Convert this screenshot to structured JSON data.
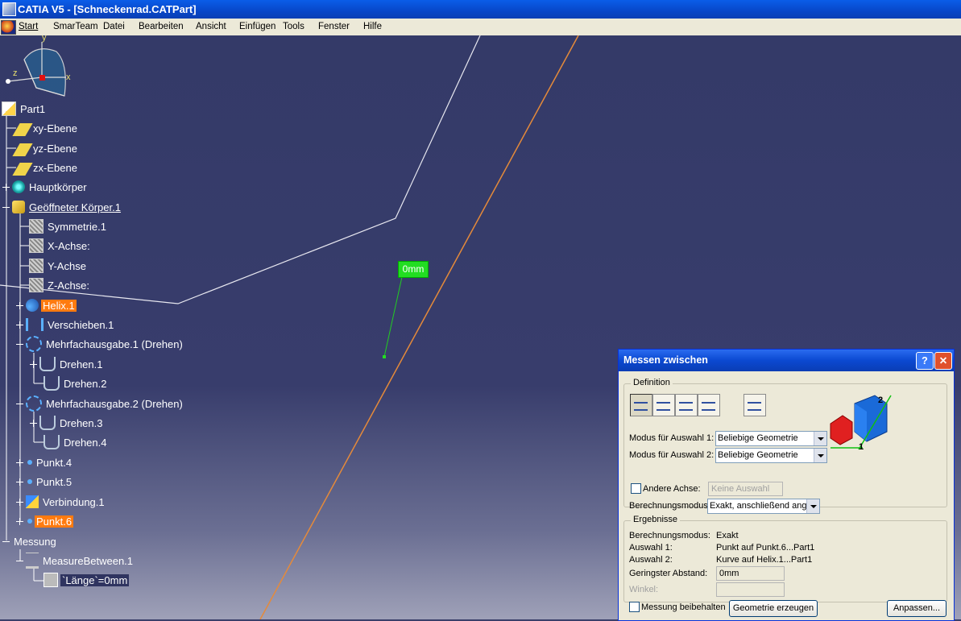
{
  "window": {
    "title": "CATIA V5 - [Schneckenrad.CATPart]"
  },
  "menu": {
    "items": [
      "Start",
      "SmarTeam",
      "Datei",
      "Bearbeiten",
      "Ansicht",
      "Einfügen",
      "Tools",
      "Fenster",
      "Hilfe"
    ]
  },
  "tree": {
    "root": "Part1",
    "xy": "xy-Ebene",
    "yz": "yz-Ebene",
    "zx": "zx-Ebene",
    "haupt": "Hauptkörper",
    "open_body": "Geöffneter Körper.1",
    "sym": "Symmetrie.1",
    "xaxis": "X-Achse:",
    "yaxis": "Y-Achse",
    "zaxis": "Z-Achse:",
    "helix": "Helix.1",
    "shift": "Verschieben.1",
    "multi1": "Mehrfachausgabe.1 (Drehen)",
    "drehen1": "Drehen.1",
    "drehen2": "Drehen.2",
    "multi2": "Mehrfachausgabe.2 (Drehen)",
    "drehen3": "Drehen.3",
    "drehen4": "Drehen.4",
    "punkt4": "Punkt.4",
    "punkt5": "Punkt.5",
    "join": "Verbindung.1",
    "punkt6": "Punkt.6",
    "measure": "Messung",
    "measure_between": "MeasureBetween.1",
    "length": "`Länge`=0mm"
  },
  "viewport": {
    "measure_label": "0mm",
    "compass_labels": {
      "y": "y",
      "x": "x",
      "z": "z"
    }
  },
  "dialog": {
    "title": "Messen zwischen",
    "help": "?",
    "close": "✕",
    "definition_label": "Definition",
    "mode1_label": "Modus für Auswahl 1:",
    "mode1_value": "Beliebige Geometrie",
    "mode2_label": "Modus für Auswahl 2:",
    "mode2_value": "Beliebige Geometrie",
    "other_axis_label": "Andere Achse:",
    "other_axis_value": "Keine Auswahl",
    "calc_mode_label": "Berechnungsmodus:",
    "calc_mode_value": "Exakt, anschließend ang",
    "results_label": "Ergebnisse",
    "res_calc_label": "Berechnungsmodus:",
    "res_calc_value": "Exakt",
    "res_sel1_label": "Auswahl 1:",
    "res_sel1_value": "Punkt auf Punkt.6...Part1",
    "res_sel2_label": "Auswahl 2:",
    "res_sel2_value": "Kurve auf Helix.1...Part1",
    "min_dist_label": "Geringster Abstand:",
    "min_dist_value": "0mm",
    "angle_label": "Winkel:",
    "keep_label": "Messung beibehalten",
    "create_geom": "Geometrie erzeugen",
    "customize": "Anpassen...",
    "preview_labels": {
      "one": "1",
      "two": "2"
    }
  },
  "colors": {
    "highlight": "#ff7b10",
    "measure_green": "#22dd22",
    "background": "#3a3f6a"
  }
}
